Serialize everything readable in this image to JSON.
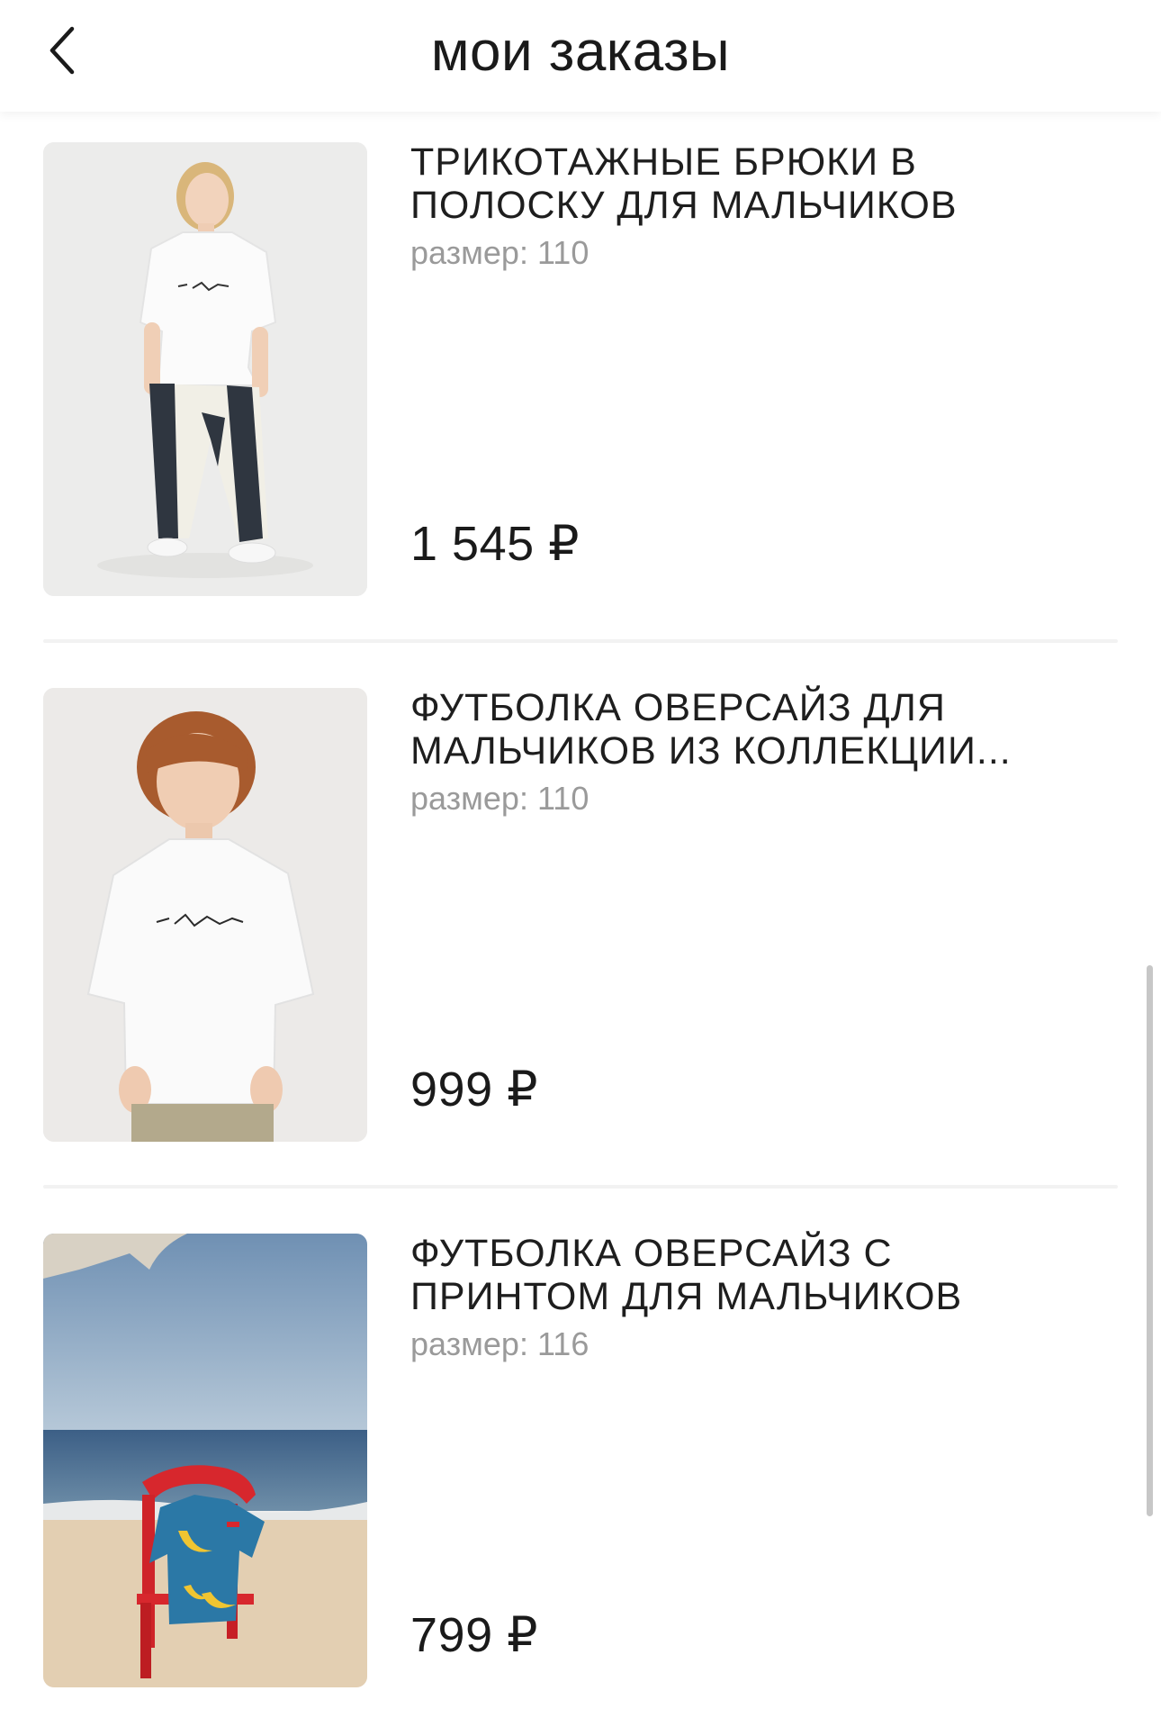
{
  "header": {
    "title": "мои заказы",
    "back_icon": "chevron-left-icon"
  },
  "orders": [
    {
      "name": "ТРИКОТАЖНЫЕ БРЮКИ В ПОЛОСКУ ДЛЯ МАЛЬЧИКОВ",
      "size": "размер: 110",
      "price": "1 545 ₽"
    },
    {
      "name": "ФУТБОЛКА ОВЕРСАЙЗ ДЛЯ МАЛЬЧИКОВ ИЗ КОЛЛЕКЦИИ...",
      "size": "размер: 110",
      "price": "999 ₽"
    },
    {
      "name": "ФУТБОЛКА ОВЕРСАЙЗ С ПРИНТОМ ДЛЯ МАЛЬЧИКОВ",
      "size": "размер: 116",
      "price": "799 ₽"
    }
  ]
}
